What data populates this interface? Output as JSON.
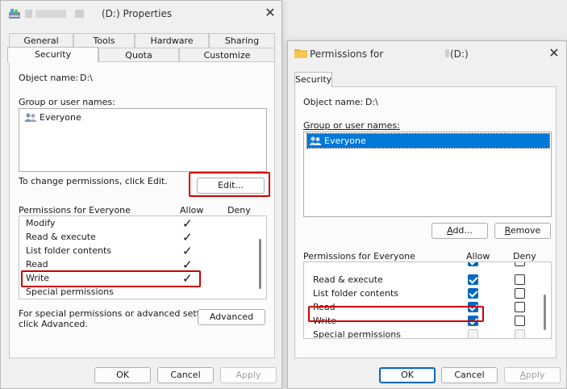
{
  "props_window": {
    "title": "(D:) Properties",
    "tabs_row1": [
      "General",
      "Tools",
      "Hardware",
      "Sharing"
    ],
    "tabs_row2": [
      "Security",
      "Quota",
      "Customize"
    ],
    "object_name_label": "Object name:",
    "object_name_value": "D:\\",
    "group_label": "Group or user names:",
    "users": [
      "Everyone"
    ],
    "change_perm_text": "To change permissions, click Edit.",
    "edit_button": "Edit...",
    "perm_for_label": "Permissions for Everyone",
    "allow_header": "Allow",
    "deny_header": "Deny",
    "permissions": [
      {
        "name": "Modify",
        "allow": true
      },
      {
        "name": "Read & execute",
        "allow": true
      },
      {
        "name": "List folder contents",
        "allow": true
      },
      {
        "name": "Read",
        "allow": true
      },
      {
        "name": "Write",
        "allow": true
      },
      {
        "name": "Special permissions",
        "allow": false
      }
    ],
    "special_text_line1": "For special permissions or advanced settings,",
    "special_text_line2": "click Advanced.",
    "advanced_button": "Advanced",
    "ok": "OK",
    "cancel": "Cancel",
    "apply": "Apply"
  },
  "perm_window": {
    "title_prefix": "Permissions for",
    "title_suffix": "(D:)",
    "tab": "Security",
    "object_name_label": "Object name:",
    "object_name_value": "D:\\",
    "group_label": "Group or user names:",
    "users": [
      "Everyone"
    ],
    "add_button": "Add...",
    "remove_button": "Remove",
    "perm_for_label": "Permissions for Everyone",
    "allow_header": "Allow",
    "deny_header": "Deny",
    "permissions": [
      {
        "name": "Read & execute",
        "allow": true,
        "deny": false
      },
      {
        "name": "List folder contents",
        "allow": true,
        "deny": false
      },
      {
        "name": "Read",
        "allow": true,
        "deny": false
      },
      {
        "name": "Write",
        "allow": true,
        "deny": false
      },
      {
        "name": "Special permissions",
        "allow": false,
        "deny": false
      }
    ],
    "ok": "OK",
    "cancel": "Cancel",
    "apply": "Apply"
  },
  "icons": {
    "check": "✓",
    "close": "✕",
    "users_icon": "users-icon",
    "folder_icon": "folder-icon",
    "drive_icon": "drive-icon"
  },
  "colors": {
    "highlight_red": "#d00000",
    "selection_blue": "#0078d7",
    "check_blue": "#0067c0"
  }
}
